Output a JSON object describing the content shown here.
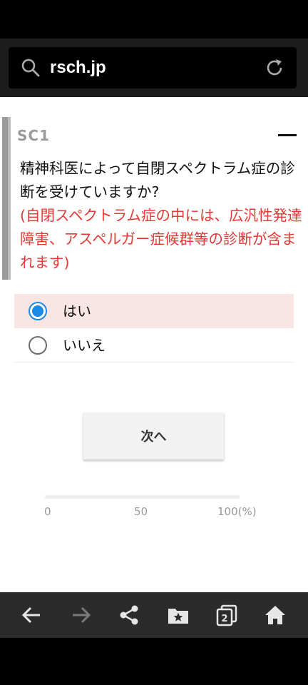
{
  "browser": {
    "url": "rsch.jp",
    "search_icon": "search-icon",
    "reload_icon": "reload-icon"
  },
  "question": {
    "id": "SC1",
    "text": "精神科医によって自閉スペクトラム症の診断を受けていますか?",
    "note": "(自閉スペクトラム症の中には、広汎性発達障害、アスペルガー症候群等の診断が含まれます)",
    "collapse_icon": "minus-icon"
  },
  "options": [
    {
      "label": "はい",
      "selected": true
    },
    {
      "label": "いいえ",
      "selected": false
    }
  ],
  "next_button": {
    "label": "次へ"
  },
  "progress": {
    "value_percent": 0,
    "ticks": [
      "0",
      "50",
      "100(%)"
    ]
  },
  "bottom_nav": {
    "icons": [
      "back-arrow-icon",
      "forward-arrow-icon",
      "share-icon",
      "bookmark-folder-icon",
      "tabs-icon",
      "home-icon"
    ],
    "tab_count": "2"
  },
  "colors": {
    "accent": "#1e88e5",
    "note_red": "#e53935",
    "selected_row": "#f9e5e3"
  }
}
